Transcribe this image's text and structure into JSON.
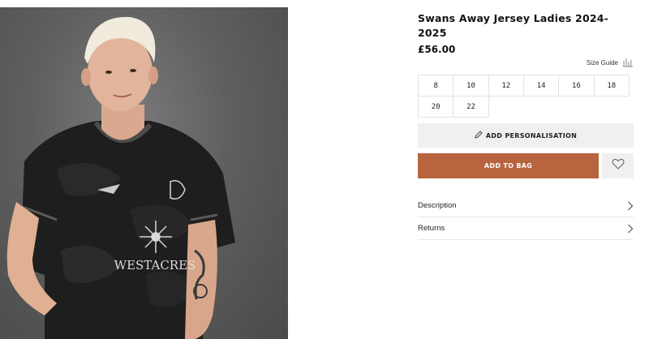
{
  "product": {
    "title": "Swans Away Jersey Ladies 2024-2025",
    "price": "£56.00",
    "image_alt": "Player wearing the black Swans away jersey",
    "shirt_sponsor": "WESTACRES"
  },
  "size_guide": {
    "label": "Size Guide",
    "icon": "ruler-icon"
  },
  "sizes": {
    "row1": [
      "8",
      "10",
      "12",
      "14",
      "16",
      "18"
    ],
    "row2": [
      "20",
      "22"
    ]
  },
  "actions": {
    "personalise_label": "ADD PERSONALISATION",
    "personalise_icon": "pencil-icon",
    "add_to_bag_label": "ADD TO BAG",
    "add_to_bag_color": "#b8643f",
    "wishlist_icon": "heart-icon"
  },
  "accordion": {
    "description_label": "Description",
    "returns_label": "Returns"
  }
}
